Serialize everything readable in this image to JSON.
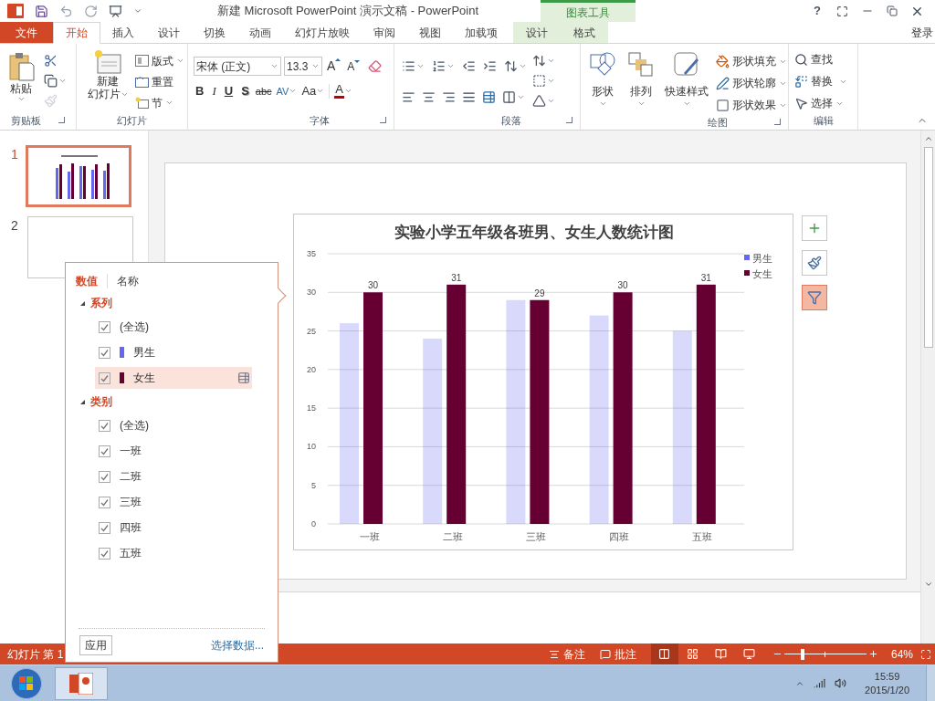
{
  "window": {
    "title": "新建 Microsoft PowerPoint 演示文稿 - PowerPoint",
    "help": "?",
    "sign_in": "登录"
  },
  "file_tab": "文件",
  "tabs": [
    {
      "label": "开始",
      "selected": true
    },
    {
      "label": "插入",
      "selected": false
    },
    {
      "label": "设计",
      "selected": false
    },
    {
      "label": "切换",
      "selected": false
    },
    {
      "label": "动画",
      "selected": false
    },
    {
      "label": "幻灯片放映",
      "selected": false
    },
    {
      "label": "审阅",
      "selected": false
    },
    {
      "label": "视图",
      "selected": false
    },
    {
      "label": "加载项",
      "selected": false
    }
  ],
  "contextual": {
    "title": "图表工具",
    "tabs": [
      {
        "label": "设计",
        "selected": false
      },
      {
        "label": "格式",
        "selected": false
      }
    ]
  },
  "ribbon": {
    "clipboard": {
      "name": "剪贴板",
      "paste": "粘贴"
    },
    "slides": {
      "name": "幻灯片",
      "new_slide": [
        "新建",
        "幻灯片"
      ],
      "layout": "版式",
      "reset": "重置",
      "section": "节"
    },
    "font": {
      "name": "字体",
      "font_name": "宋体 (正文)",
      "font_size": "13.3",
      "grow": "A",
      "shrink": "A",
      "bold": "B",
      "italic": "I",
      "underline": "U",
      "shadow": "S",
      "strike": "abc",
      "spacing": "AV",
      "case": "Aa",
      "font_color_glyph": "A"
    },
    "paragraph": {
      "name": "段落"
    },
    "drawing": {
      "name": "绘图",
      "shapes": "形状",
      "arrange": "排列",
      "quick_styles": "快速样式",
      "fill": "形状填充",
      "outline": "形状轮廓",
      "effects": "形状效果"
    },
    "editing": {
      "name": "编辑",
      "find": "查找",
      "replace": "替换",
      "select": "选择"
    }
  },
  "thumbnails": [
    {
      "number": "1",
      "selected": true
    },
    {
      "number": "2",
      "selected": false
    }
  ],
  "chart": {
    "chart_data": {
      "type": "bar",
      "title": "实验小学五年级各班男、女生人数统计图",
      "categories": [
        "一班",
        "二班",
        "三班",
        "四班",
        "五班"
      ],
      "series": [
        {
          "name": "男生",
          "color": "#6666ee",
          "values": [
            26,
            24,
            29,
            27,
            25
          ]
        },
        {
          "name": "女生",
          "color": "#660033",
          "values": [
            30,
            31,
            29,
            30,
            31
          ]
        }
      ],
      "ylim": [
        0,
        35
      ],
      "yticks": [
        0,
        5,
        10,
        15,
        20,
        25,
        30,
        35
      ],
      "value_labels": [
        null,
        [
          "30",
          "31",
          "29",
          "30",
          "31"
        ]
      ],
      "grid": true,
      "legend": "right"
    }
  },
  "chart_buttons": [
    {
      "kind": "add",
      "selected": false
    },
    {
      "kind": "style",
      "selected": false
    },
    {
      "kind": "filter",
      "selected": true
    }
  ],
  "filter_panel": {
    "tabs": [
      {
        "label": "数值",
        "selected": true
      },
      {
        "label": "名称",
        "selected": false
      }
    ],
    "sections": [
      {
        "title": "系列",
        "expanded": true,
        "items": [
          {
            "label": "(全选)",
            "checked": true,
            "selected": false
          },
          {
            "label": "男生",
            "color": "#6666ee",
            "checked": true,
            "selected": false
          },
          {
            "label": "女生",
            "color": "#660033",
            "checked": true,
            "selected": true
          }
        ]
      },
      {
        "title": "类别",
        "expanded": true,
        "items": [
          {
            "label": "(全选)",
            "checked": true,
            "selected": false
          },
          {
            "label": "一班",
            "checked": true,
            "selected": false
          },
          {
            "label": "二班",
            "checked": true,
            "selected": false
          },
          {
            "label": "三班",
            "checked": true,
            "selected": false
          },
          {
            "label": "四班",
            "checked": true,
            "selected": false
          },
          {
            "label": "五班",
            "checked": true,
            "selected": false
          }
        ]
      }
    ],
    "apply": "应用",
    "select_data": "选择数据..."
  },
  "status_bar": {
    "slide_info": "幻灯片 第 1",
    "notes": "备注",
    "comments": "批注",
    "zoom": {
      "level": 0.22,
      "reading": "64%"
    }
  },
  "taskbar": {
    "time": "15:59",
    "date": "2015/1/20"
  }
}
